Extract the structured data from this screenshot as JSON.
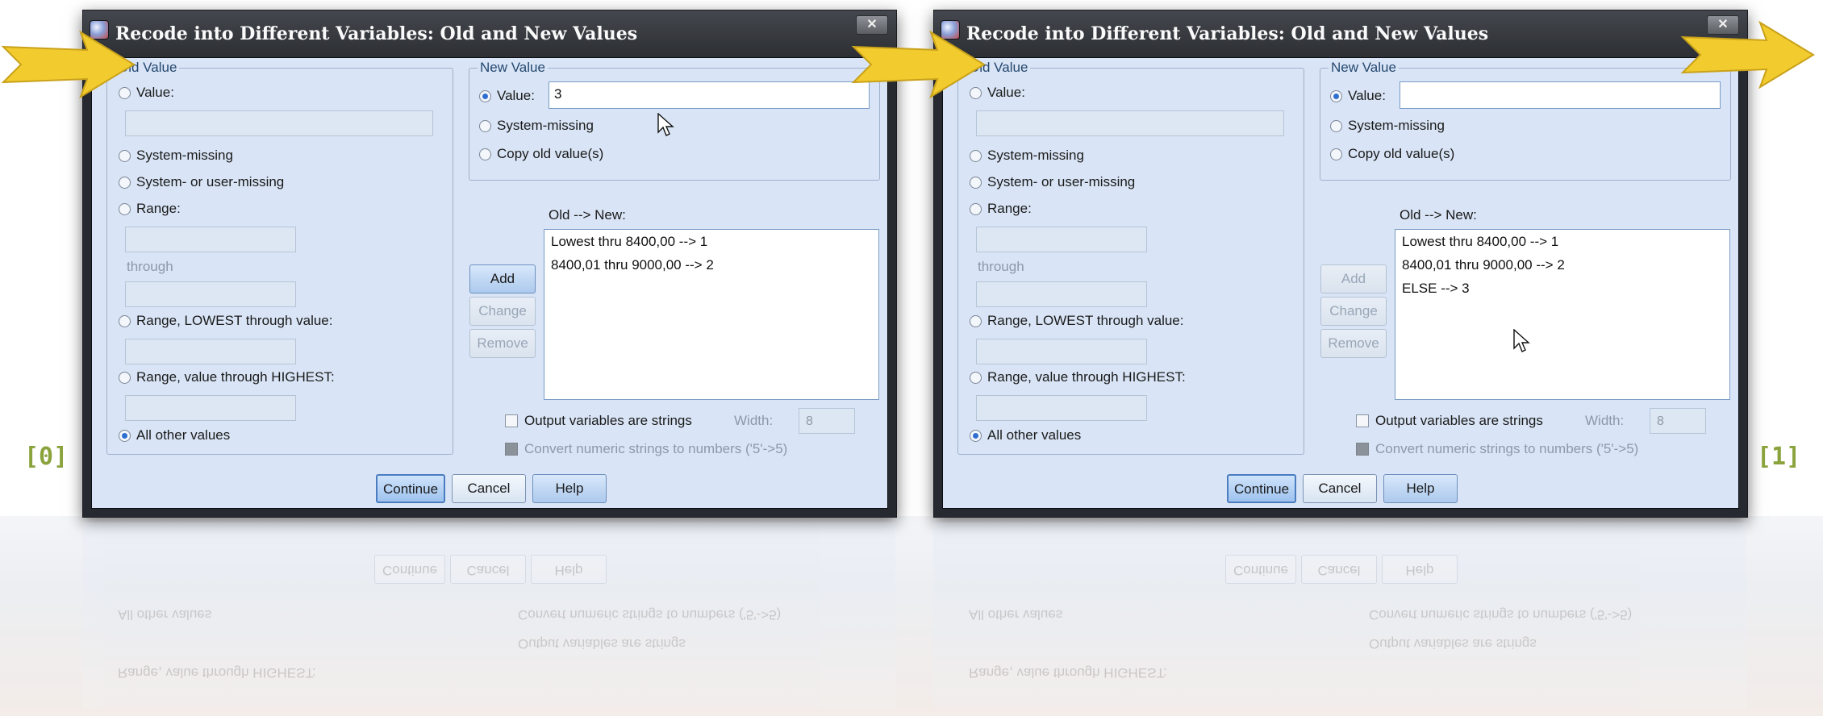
{
  "panel_labels": [
    "[0]",
    "[1]"
  ],
  "dialogs": [
    {
      "title": "Recode into Different Variables: Old and New Values",
      "old_value": {
        "group_label": "Old Value",
        "opt_value": "Value:",
        "opt_system_missing": "System-missing",
        "opt_sys_user_missing": "System- or user-missing",
        "opt_range": "Range:",
        "through": "through",
        "opt_range_lowest": "Range, LOWEST through value:",
        "opt_range_highest": "Range, value through HIGHEST:",
        "opt_all_other": "All other values",
        "selected": "All other values"
      },
      "new_value": {
        "group_label": "New Value",
        "opt_value": "Value:",
        "value_input": "3",
        "opt_system_missing": "System-missing",
        "opt_copy_old": "Copy old value(s)",
        "selected": "Value:"
      },
      "mapping": {
        "label": "Old --> New:",
        "items": [
          "Lowest thru 8400,00 --> 1",
          "8400,01 thru 9000,00 --> 2"
        ]
      },
      "buttons": {
        "add": "Add",
        "change": "Change",
        "remove": "Remove"
      },
      "add_enabled": true,
      "output_strings": "Output variables are strings",
      "width_label": "Width:",
      "width_value": "8",
      "convert_numeric": "Convert numeric strings to numbers ('5'->5)",
      "footer": {
        "continue": "Continue",
        "cancel": "Cancel",
        "help": "Help"
      }
    },
    {
      "title": "Recode into Different Variables: Old and New Values",
      "old_value": {
        "group_label": "Old Value",
        "opt_value": "Value:",
        "opt_system_missing": "System-missing",
        "opt_sys_user_missing": "System- or user-missing",
        "opt_range": "Range:",
        "through": "through",
        "opt_range_lowest": "Range, LOWEST through value:",
        "opt_range_highest": "Range, value through HIGHEST:",
        "opt_all_other": "All other values",
        "selected": "All other values"
      },
      "new_value": {
        "group_label": "New Value",
        "opt_value": "Value:",
        "value_input": "",
        "opt_system_missing": "System-missing",
        "opt_copy_old": "Copy old value(s)",
        "selected": "Value:"
      },
      "mapping": {
        "label": "Old --> New:",
        "items": [
          "Lowest thru 8400,00 --> 1",
          "8400,01 thru 9000,00 --> 2",
          "ELSE --> 3"
        ]
      },
      "buttons": {
        "add": "Add",
        "change": "Change",
        "remove": "Remove"
      },
      "add_enabled": false,
      "output_strings": "Output variables are strings",
      "width_label": "Width:",
      "width_value": "8",
      "convert_numeric": "Convert numeric strings to numbers ('5'->5)",
      "footer": {
        "continue": "Continue",
        "cancel": "Cancel",
        "help": "Help"
      }
    }
  ],
  "colors": {
    "arrow": "#f2cc2e",
    "dialog_bg": "#d9e5f6",
    "badge": "#8aa33c"
  }
}
